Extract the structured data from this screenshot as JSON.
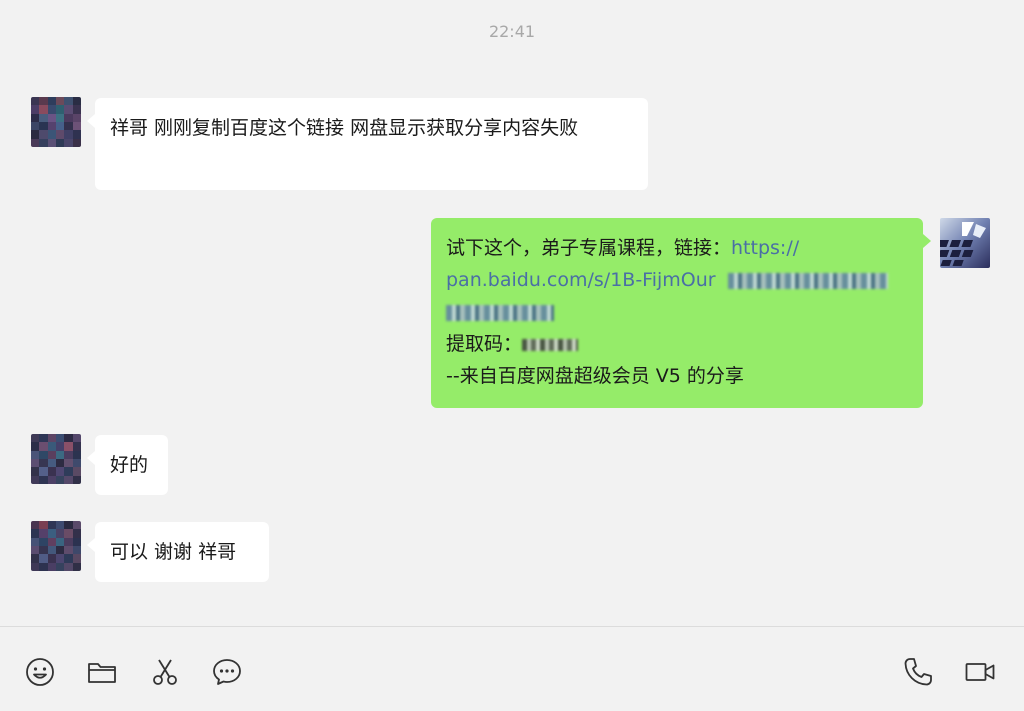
{
  "chat": {
    "timestamp": "22:41",
    "messages": [
      {
        "side": "in",
        "text": "祥哥 刚刚复制百度这个链接 网盘显示获取分享内容失败"
      },
      {
        "side": "out",
        "line1_text": "试下这个，弟子专属课程，链接：",
        "line1_link": "https://",
        "line2_link": "pan.baidu.com/s/1B-FijmOur",
        "line4_label": "提取码：",
        "line5_text": "--来自百度网盘超级会员 V5 的分享"
      },
      {
        "side": "in",
        "text": "好的"
      },
      {
        "side": "in",
        "text": "可以 谢谢 祥哥"
      }
    ]
  },
  "composer": {
    "tools_left": [
      "emoji-icon",
      "folder-icon",
      "scissors-icon",
      "chat-bubble-icon"
    ],
    "tools_right": [
      "phone-icon",
      "video-icon"
    ]
  },
  "colors": {
    "background": "#f2f2f2",
    "incoming_bubble": "#ffffff",
    "outgoing_bubble": "#95ec69",
    "link": "#4a6fa5"
  }
}
